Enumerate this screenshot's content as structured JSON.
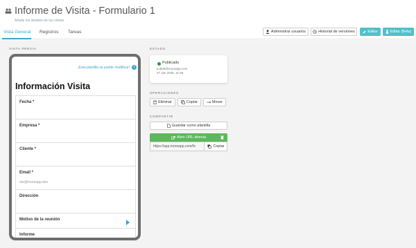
{
  "header": {
    "title": "Informe de Visita - Formulario 1",
    "subtitle": "Añade los detalles de tus visitas"
  },
  "tabs": [
    {
      "label": "Vista General",
      "active": true
    },
    {
      "label": "Registros",
      "active": false
    },
    {
      "label": "Tareas",
      "active": false
    }
  ],
  "toolbar": {
    "admin_users": "Administrar usuarios",
    "version_history": "Historial de versiones",
    "edit": "Editar",
    "edit_beta": "Editar (Beta)"
  },
  "preview": {
    "section_label": "VISTA PREVIA",
    "link": "¡Esta plantilla se puede modificar!",
    "form_title": "Información Visita",
    "fields": [
      {
        "label": "Fecha *",
        "value": ""
      },
      {
        "label": "Empresa *",
        "value": ""
      },
      {
        "label": "Cliente *",
        "value": ""
      },
      {
        "label": "Email *",
        "value": "me@moreapp.dev"
      },
      {
        "label": "Dirección",
        "value": ""
      },
      {
        "label": "Motivo de la reunión",
        "value": ""
      },
      {
        "label": "Informe",
        "value": ""
      }
    ]
  },
  "status": {
    "section_label": "ESTADO",
    "state": "Publicado",
    "email": "a.abril@moreapp.com",
    "date": "27 Jan 2026, 11:58"
  },
  "operations": {
    "section_label": "OPERACIONES",
    "delete": "Eliminar",
    "copy": "Copiar",
    "move": "Mover"
  },
  "share": {
    "section_label": "COMPARTIR",
    "save_template": "Guardar como plantilla",
    "open_url": "Abrir URL directa",
    "url_value": "https://app.moreapp.com/fo",
    "copy": "Copiar"
  },
  "colors": {
    "accent": "#3aa6c6",
    "teal_button": "#50c1c9",
    "green_bar": "#5cb85c",
    "published_dot": "#2e9a3a"
  }
}
